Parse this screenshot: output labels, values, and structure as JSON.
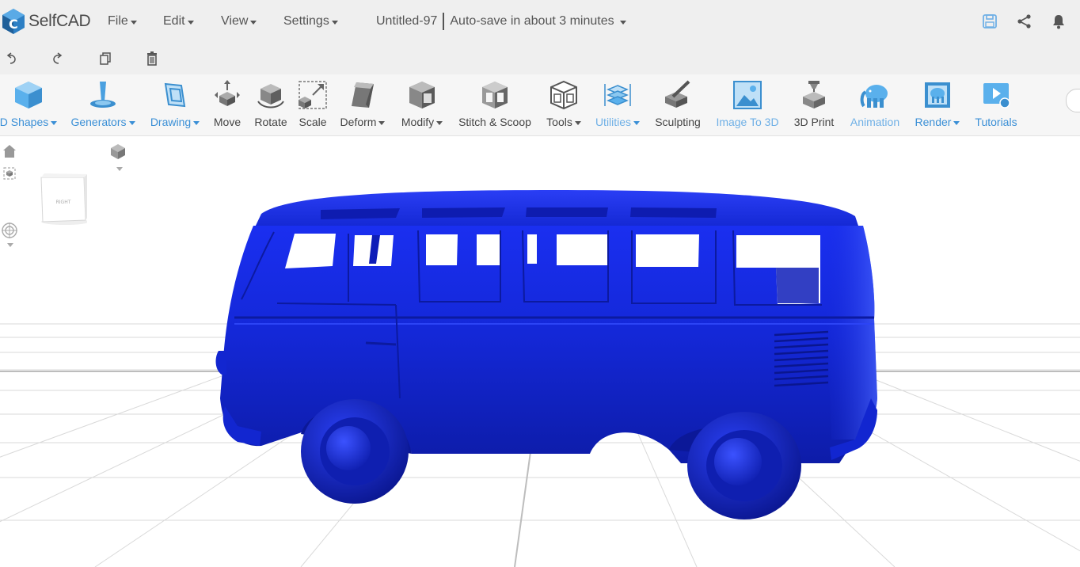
{
  "app": {
    "name": "SelfCAD",
    "document_title": "Untitled-97",
    "autosave_text": "Auto-save in about 3 minutes"
  },
  "menubar": {
    "items": [
      {
        "label": "File"
      },
      {
        "label": "Edit"
      },
      {
        "label": "View"
      },
      {
        "label": "Settings"
      }
    ],
    "right_icons": [
      "save-icon",
      "share-icon",
      "bell-icon"
    ]
  },
  "quickbar": {
    "icons": [
      "undo-icon",
      "redo-icon",
      "copy-icon",
      "delete-icon"
    ]
  },
  "toolbar": {
    "tools": [
      {
        "label": "D Shapes",
        "dropdown": true,
        "style": "blue"
      },
      {
        "label": "Generators",
        "dropdown": true,
        "style": "blue"
      },
      {
        "label": "Drawing",
        "dropdown": true,
        "style": "blue"
      },
      {
        "label": "Move",
        "dropdown": false,
        "style": "dark"
      },
      {
        "label": "Rotate",
        "dropdown": false,
        "style": "dark"
      },
      {
        "label": "Scale",
        "dropdown": false,
        "style": "dark"
      },
      {
        "label": "Deform",
        "dropdown": true,
        "style": "dark"
      },
      {
        "label": "Modify",
        "dropdown": true,
        "style": "dark"
      },
      {
        "label": "Stitch & Scoop",
        "dropdown": false,
        "style": "dark"
      },
      {
        "label": "Tools",
        "dropdown": true,
        "style": "dark"
      },
      {
        "label": "Utilities",
        "dropdown": true,
        "style": "ltblue"
      },
      {
        "label": "Sculpting",
        "dropdown": false,
        "style": "dark"
      },
      {
        "label": "Image To 3D",
        "dropdown": false,
        "style": "ltblue"
      },
      {
        "label": "3D Print",
        "dropdown": false,
        "style": "dark"
      },
      {
        "label": "Animation",
        "dropdown": false,
        "style": "ltblue"
      },
      {
        "label": "Render",
        "dropdown": true,
        "style": "blue"
      },
      {
        "label": "Tutorials",
        "dropdown": false,
        "style": "blue"
      }
    ]
  },
  "viewport": {
    "viewcube_face": "RIGHT",
    "model_color": "#1428d8",
    "grid_color": "#d8d8d8"
  },
  "colors": {
    "accent": "#3a8fd6",
    "menubar_bg": "#efefef",
    "model_blue": "#1428d8"
  }
}
